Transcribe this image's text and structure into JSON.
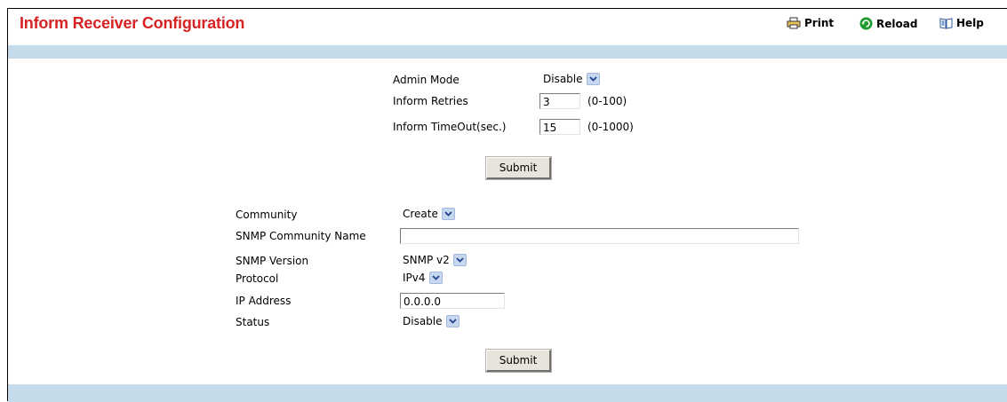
{
  "header": {
    "title": "Inform Receiver Configuration",
    "toolbar": {
      "print_label": "Print",
      "reload_label": "Reload",
      "help_label": "Help"
    }
  },
  "inform_settings": {
    "admin_mode": {
      "label": "Admin Mode",
      "value": "Disable"
    },
    "retries": {
      "label": "Inform Retries",
      "value": "3",
      "range": "(0-100)"
    },
    "timeout": {
      "label": "Inform TimeOut(sec.)",
      "value": "15",
      "range": "(0-1000)"
    },
    "submit_label": "Submit"
  },
  "receiver": {
    "community": {
      "label": "Community",
      "value": "Create"
    },
    "community_name": {
      "label": "SNMP Community Name",
      "value": ""
    },
    "snmp_version": {
      "label": "SNMP Version",
      "value": "SNMP v2"
    },
    "protocol": {
      "label": "Protocol",
      "value": "IPv4"
    },
    "ip_address": {
      "label": "IP Address",
      "value": "0.0.0.0"
    },
    "status": {
      "label": "Status",
      "value": "Disable"
    },
    "submit_label": "Submit"
  },
  "colors": {
    "title": "#d72323",
    "bar": "#c5dbe9",
    "dropdown_arrow_bg": "#c7d7f0",
    "reload_icon": "#1e9a2e"
  },
  "icons": {
    "print": "printer-icon",
    "reload": "reload-icon",
    "help": "help-book-icon",
    "dropdown": "chevron-down-icon"
  }
}
